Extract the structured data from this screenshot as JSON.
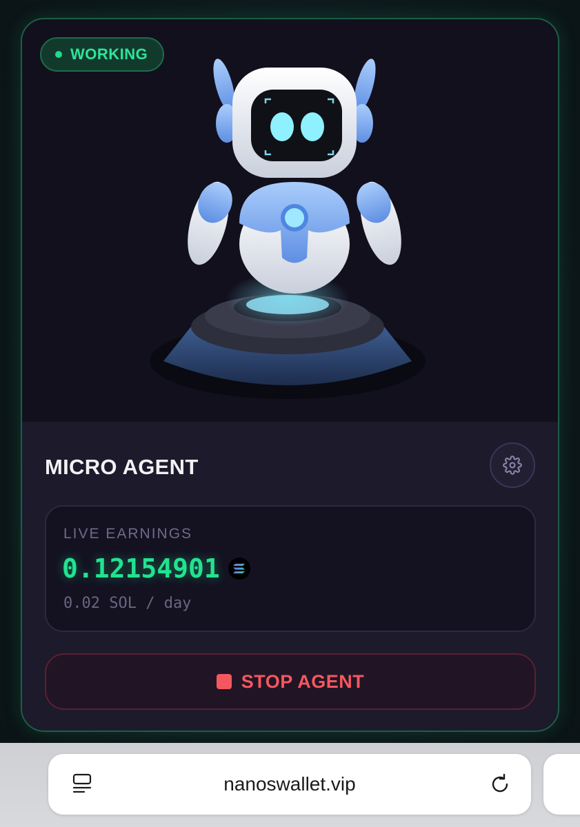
{
  "agent": {
    "status": "WORKING",
    "name": "MICRO AGENT",
    "image_label": "robot-agent-illustration"
  },
  "earnings": {
    "label": "LIVE EARNINGS",
    "value": "0.12154901",
    "currency_icon": "solana-icon",
    "rate": "0.02 SOL / day"
  },
  "actions": {
    "stop_label": "STOP AGENT",
    "settings_icon": "gear-icon"
  },
  "browser": {
    "url": "nanoswallet.vip",
    "left_icon": "tabs-icon",
    "right_icon": "reload-icon"
  },
  "colors": {
    "accent_green": "#22e38f",
    "stop_red": "#f4585e",
    "card_bg": "#1c1a2b"
  }
}
